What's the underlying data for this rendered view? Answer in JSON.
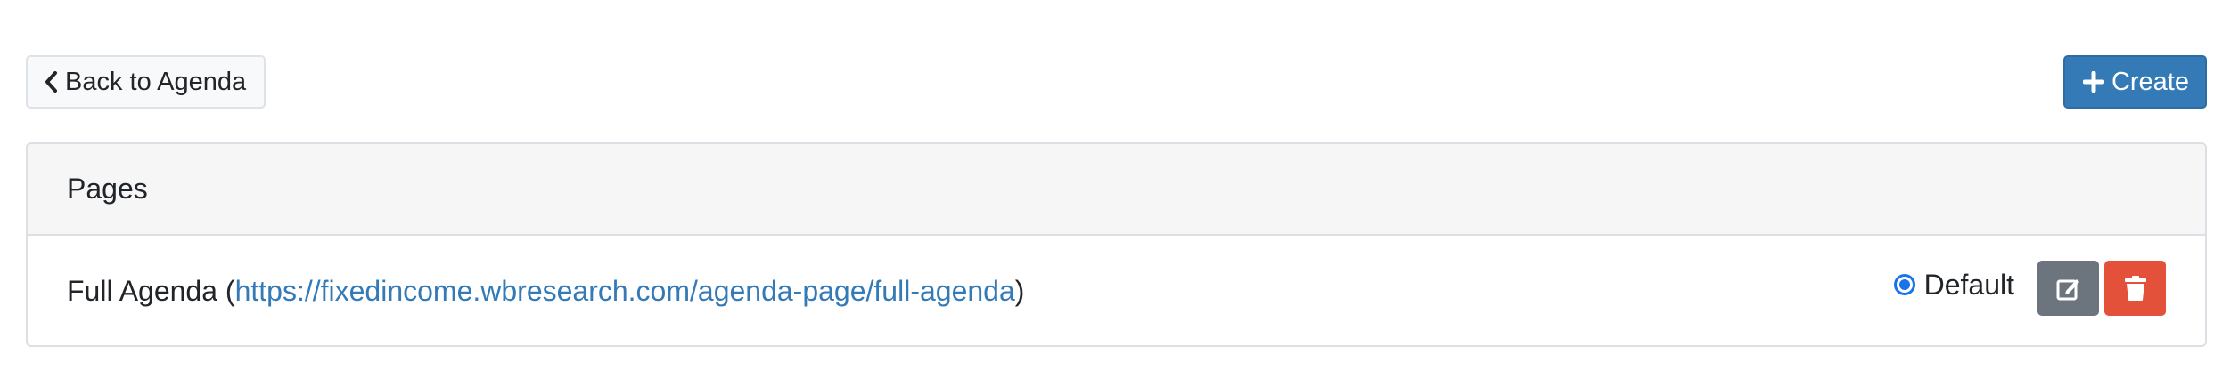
{
  "toolbar": {
    "back_label": "Back to Agenda",
    "create_label": "Create"
  },
  "card": {
    "title": "Pages",
    "rows": [
      {
        "name": "Full Agenda",
        "open_paren": " (",
        "url": "https://fixedincome.wbresearch.com/agenda-page/full-agenda",
        "close_paren": ")",
        "default_label": "Default"
      }
    ]
  },
  "icons": {
    "back": "chevron-left-icon",
    "create": "plus-icon",
    "edit": "edit-icon",
    "delete": "trash-icon"
  },
  "colors": {
    "primary": "#337ab7",
    "secondary": "#6c757d",
    "danger": "#e4513a",
    "radio": "#1a73e8"
  }
}
